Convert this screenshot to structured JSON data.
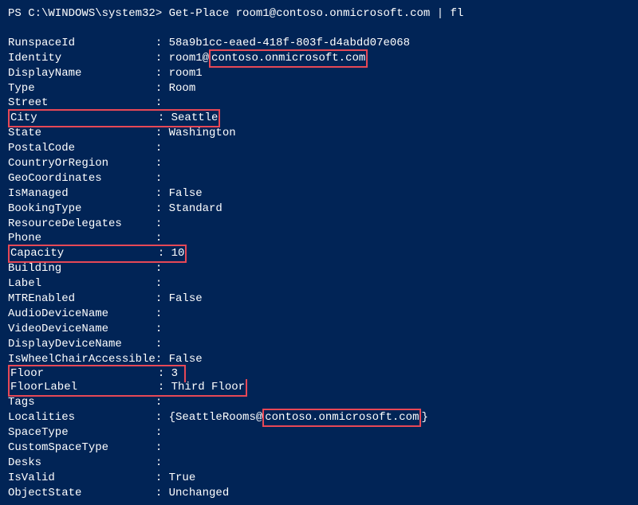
{
  "prompt": {
    "prefix": "PS C:\\WINDOWS\\system32> ",
    "command": "Get-Place room1@contoso.onmicrosoft.com | fl"
  },
  "output": {
    "identity_prefix": "room1@",
    "identity_domain": "contoso.onmicrosoft.com",
    "localities_prefix": "{SeattleRooms@",
    "localities_domain": "contoso.onmicrosoft.com",
    "localities_suffix": "}",
    "rows": [
      {
        "key": "RunspaceId",
        "value": "58a9b1cc-eaed-418f-803f-d4abdd07e068",
        "style": "plain"
      },
      {
        "key": "Identity",
        "style": "identity"
      },
      {
        "key": "DisplayName",
        "value": "room1",
        "style": "plain"
      },
      {
        "key": "Type",
        "value": "Room",
        "style": "plain"
      },
      {
        "key": "Street",
        "value": "",
        "style": "plain"
      },
      {
        "key": "City",
        "value": "Seattle",
        "style": "rowbox"
      },
      {
        "key": "State",
        "value": "Washington",
        "style": "plain"
      },
      {
        "key": "PostalCode",
        "value": "",
        "style": "plain"
      },
      {
        "key": "CountryOrRegion",
        "value": "",
        "style": "plain"
      },
      {
        "key": "GeoCoordinates",
        "value": "",
        "style": "plain"
      },
      {
        "key": "IsManaged",
        "value": "False",
        "style": "plain"
      },
      {
        "key": "BookingType",
        "value": "Standard",
        "style": "plain"
      },
      {
        "key": "ResourceDelegates",
        "value": "",
        "style": "plain"
      },
      {
        "key": "Phone",
        "value": "",
        "style": "plain"
      },
      {
        "key": "Capacity",
        "value": "10",
        "style": "rowbox"
      },
      {
        "key": "Building",
        "value": "",
        "style": "plain"
      },
      {
        "key": "Label",
        "value": "",
        "style": "plain"
      },
      {
        "key": "MTREnabled",
        "value": "False",
        "style": "plain"
      },
      {
        "key": "AudioDeviceName",
        "value": "",
        "style": "plain"
      },
      {
        "key": "VideoDeviceName",
        "value": "",
        "style": "plain"
      },
      {
        "key": "DisplayDeviceName",
        "value": "",
        "style": "plain"
      },
      {
        "key": "IsWheelChairAccessible",
        "value": "False",
        "style": "plain"
      },
      {
        "key": "Floor",
        "value": "3",
        "style": "rowbox-open"
      },
      {
        "key": "FloorLabel",
        "value": "Third Floor",
        "style": "rowbox-close"
      },
      {
        "key": "Tags",
        "value": "",
        "style": "plain"
      },
      {
        "key": "Localities",
        "style": "localities"
      },
      {
        "key": "SpaceType",
        "value": "",
        "style": "plain"
      },
      {
        "key": "CustomSpaceType",
        "value": "",
        "style": "plain"
      },
      {
        "key": "Desks",
        "value": "",
        "style": "plain"
      },
      {
        "key": "IsValid",
        "value": "True",
        "style": "plain"
      },
      {
        "key": "ObjectState",
        "value": "Unchanged",
        "style": "plain"
      }
    ]
  }
}
